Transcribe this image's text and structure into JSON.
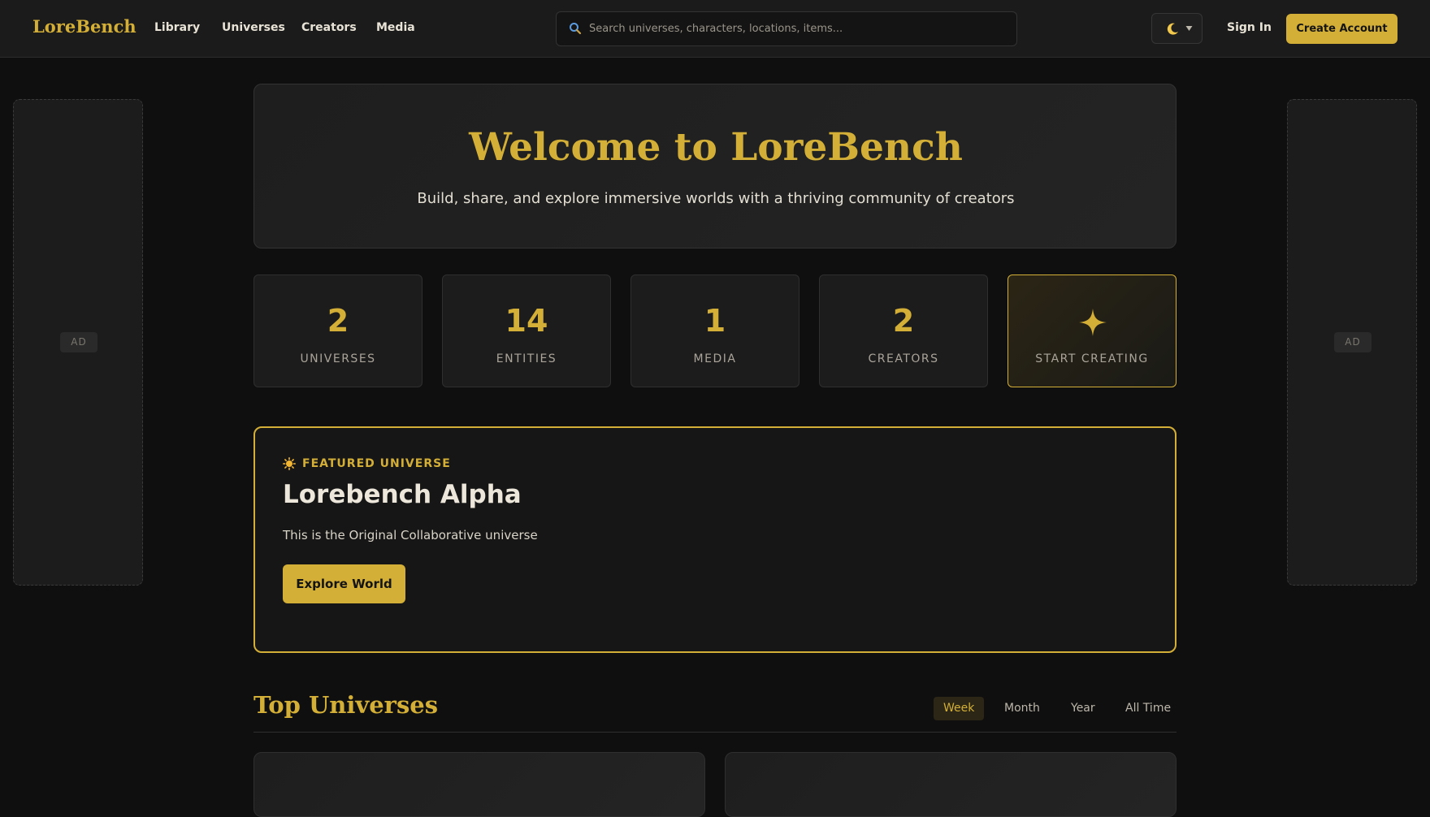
{
  "header": {
    "logo": "LoreBench",
    "nav": [
      "Library",
      "Universes",
      "Creators",
      "Media"
    ],
    "search_placeholder": "Search universes, characters, locations, items...",
    "sign_in": "Sign In",
    "create_account": "Create Account"
  },
  "ads": {
    "label": "AD"
  },
  "hero": {
    "title": "Welcome to LoreBench",
    "subtitle": "Build, share, and explore immersive worlds with a thriving community of creators"
  },
  "stats": [
    {
      "value": "2",
      "label": "UNIVERSES"
    },
    {
      "value": "14",
      "label": "ENTITIES"
    },
    {
      "value": "1",
      "label": "MEDIA"
    },
    {
      "value": "2",
      "label": "CREATORS"
    }
  ],
  "cta": {
    "label": "START CREATING"
  },
  "featured": {
    "kicker": "FEATURED UNIVERSE",
    "title": "Lorebench Alpha",
    "description": "This is the Original Collaborative universe",
    "button": "Explore World"
  },
  "top_universes": {
    "title": "Top Universes",
    "tabs": [
      "Week",
      "Month",
      "Year",
      "All Time"
    ],
    "active_tab": "Week"
  },
  "colors": {
    "accent": "#d4af37",
    "background": "#0f0f0f",
    "surface": "#1c1c1c"
  }
}
